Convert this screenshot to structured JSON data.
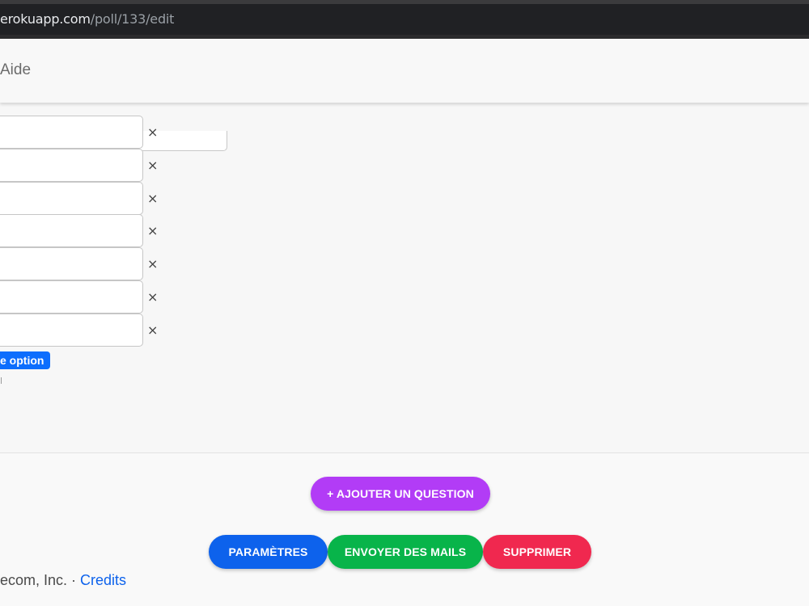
{
  "browser": {
    "url_domain": "erokuapp.com",
    "url_path": "/poll/133/edit"
  },
  "navbar": {
    "help_label": "Aide"
  },
  "options": {
    "remove_symbol": "×",
    "add_option_label": "e option"
  },
  "actions": {
    "add_question_label": "+ AJOUTER UN QUESTION",
    "settings_label": "PARAMÈTRES",
    "send_mails_label": "ENVOYER DES MAILS",
    "delete_label": "SUPPRIMER"
  },
  "footer": {
    "company_text": "ecom, Inc. · ",
    "credits_label": "Credits"
  },
  "colors": {
    "add_question": "#b23cf6",
    "settings": "#0d62ec",
    "send_mails": "#08b44a",
    "delete": "#f0284f",
    "add_option": "#0d6efd"
  }
}
